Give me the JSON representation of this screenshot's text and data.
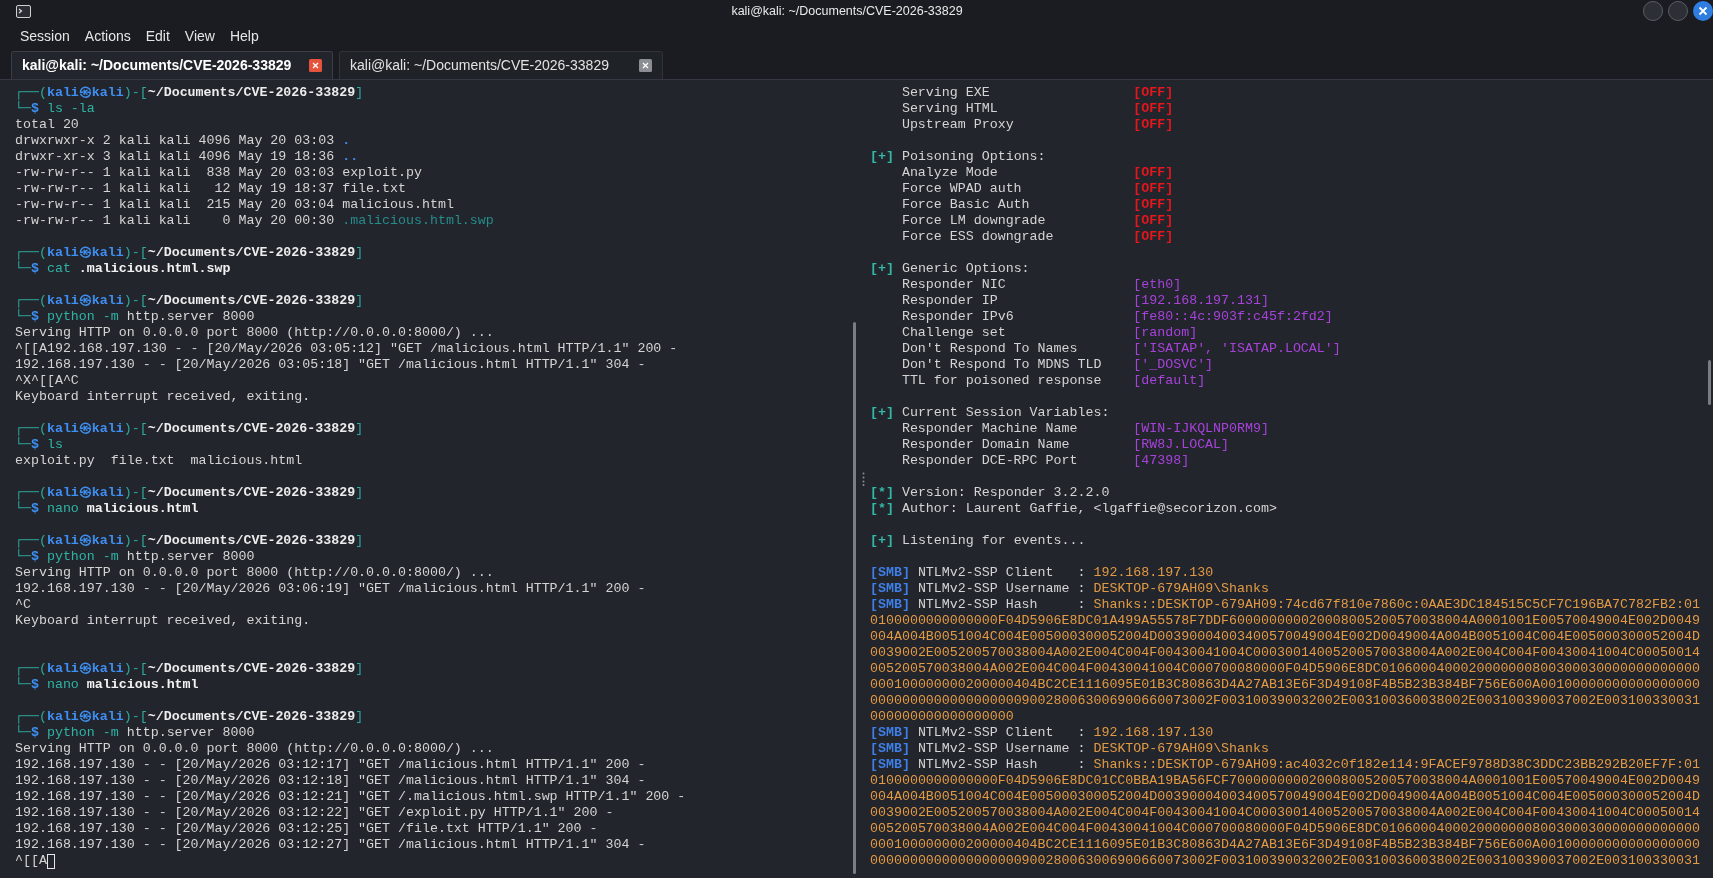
{
  "window": {
    "title": "kali@kali: ~/Documents/CVE-2026-33829"
  },
  "menu": [
    "Session",
    "Actions",
    "Edit",
    "View",
    "Help"
  ],
  "tabs": [
    {
      "label": "kali@kali: ~/Documents/CVE-2026-33829",
      "selected": true
    },
    {
      "label": "kali@kali: ~/Documents/CVE-2026-33829",
      "selected": false
    }
  ],
  "left_pane": {
    "blocks": [
      {
        "lines": [
          {
            "kind": "prompt",
            "open": "┌──(",
            "user": "kali㉿kali",
            "separator": ")-[",
            "path": "~/Documents/CVE-2026-33829",
            "close": "]"
          },
          {
            "kind": "command",
            "corner": "└─",
            "sigil": "$",
            "command": " ls -la"
          },
          {
            "kind": "output",
            "text": "total 20"
          },
          {
            "kind": "listing",
            "text": "drwxrwxr-x 2 kali kali 4096 May 20 03:03 ",
            "entry": {
              "kind": "directory",
              "text": "."
            }
          },
          {
            "kind": "listing",
            "text": "drwxr-xr-x 3 kali kali 4096 May 19 18:36 ",
            "entry": {
              "kind": "directory",
              "text": ".."
            }
          },
          {
            "kind": "output",
            "text": "-rw-rw-r-- 1 kali kali  838 May 20 03:03 exploit.py"
          },
          {
            "kind": "output",
            "text": "-rw-rw-r-- 1 kali kali   12 May 19 18:37 file.txt"
          },
          {
            "kind": "output",
            "text": "-rw-rw-r-- 1 kali kali  215 May 20 03:04 malicious.html"
          },
          {
            "kind": "listing",
            "text": "-rw-rw-r-- 1 kali kali    0 May 20 00:30 ",
            "entry": {
              "kind": "swap",
              "text": ".malicious.html.swp"
            }
          }
        ]
      },
      {
        "lines": [
          {
            "kind": "prompt",
            "open": "┌──(",
            "user": "kali㉿kali",
            "separator": ")-[",
            "path": "~/Documents/CVE-2026-33829",
            "close": "]"
          },
          {
            "kind": "command",
            "corner": "└─",
            "sigil": "$",
            "command": " cat",
            "file": " .malicious.html.swp"
          }
        ]
      },
      {
        "lines": [
          {
            "kind": "prompt",
            "open": "┌──(",
            "user": "kali㉿kali",
            "separator": ")-[",
            "path": "~/Documents/CVE-2026-33829",
            "close": "]"
          },
          {
            "kind": "command",
            "corner": "└─",
            "sigil": "$",
            "command": " python -m",
            "arguments": " http.server 8000"
          },
          {
            "kind": "output",
            "text": "Serving HTTP on 0.0.0.0 port 8000 (http://0.0.0.0:8000/) ..."
          },
          {
            "kind": "output",
            "text": "^[[A192.168.197.130 - - [20/May/2026 03:05:12] \"GET /malicious.html HTTP/1.1\" 200 -"
          },
          {
            "kind": "output",
            "text": "192.168.197.130 - - [20/May/2026 03:05:18] \"GET /malicious.html HTTP/1.1\" 304 -"
          },
          {
            "kind": "output",
            "text": "^X^[[A^C"
          },
          {
            "kind": "output",
            "text": "Keyboard interrupt received, exiting."
          }
        ]
      },
      {
        "lines": [
          {
            "kind": "prompt",
            "open": "┌──(",
            "user": "kali㉿kali",
            "separator": ")-[",
            "path": "~/Documents/CVE-2026-33829",
            "close": "]"
          },
          {
            "kind": "command",
            "corner": "└─",
            "sigil": "$",
            "command": " ls"
          },
          {
            "kind": "output",
            "text": "exploit.py  file.txt  malicious.html"
          }
        ]
      },
      {
        "lines": [
          {
            "kind": "prompt",
            "open": "┌──(",
            "user": "kali㉿kali",
            "separator": ")-[",
            "path": "~/Documents/CVE-2026-33829",
            "close": "]"
          },
          {
            "kind": "command",
            "corner": "└─",
            "sigil": "$",
            "command": " nano",
            "file": " malicious.html"
          }
        ]
      },
      {
        "lines": [
          {
            "kind": "prompt",
            "open": "┌──(",
            "user": "kali㉿kali",
            "separator": ")-[",
            "path": "~/Documents/CVE-2026-33829",
            "close": "]"
          },
          {
            "kind": "command",
            "corner": "└─",
            "sigil": "$",
            "command": " python -m",
            "arguments": " http.server 8000"
          },
          {
            "kind": "output",
            "text": "Serving HTTP on 0.0.0.0 port 8000 (http://0.0.0.0:8000/) ..."
          },
          {
            "kind": "output",
            "text": "192.168.197.130 - - [20/May/2026 03:06:19] \"GET /malicious.html HTTP/1.1\" 200 -"
          },
          {
            "kind": "output",
            "text": "^C"
          },
          {
            "kind": "output",
            "text": "Keyboard interrupt received, exiting."
          }
        ]
      },
      {
        "extra_gap": true,
        "lines": [
          {
            "kind": "prompt",
            "open": "┌──(",
            "user": "kali㉿kali",
            "separator": ")-[",
            "path": "~/Documents/CVE-2026-33829",
            "close": "]"
          },
          {
            "kind": "command",
            "corner": "└─",
            "sigil": "$",
            "command": " nano",
            "file": " malicious.html"
          }
        ]
      },
      {
        "lines": [
          {
            "kind": "prompt",
            "open": "┌──(",
            "user": "kali㉿kali",
            "separator": ")-[",
            "path": "~/Documents/CVE-2026-33829",
            "close": "]"
          },
          {
            "kind": "command",
            "corner": "└─",
            "sigil": "$",
            "command": " python -m",
            "arguments": " http.server 8000"
          },
          {
            "kind": "output",
            "text": "Serving HTTP on 0.0.0.0 port 8000 (http://0.0.0.0:8000/) ..."
          },
          {
            "kind": "output",
            "text": "192.168.197.130 - - [20/May/2026 03:12:17] \"GET /malicious.html HTTP/1.1\" 200 -"
          },
          {
            "kind": "output",
            "text": "192.168.197.130 - - [20/May/2026 03:12:18] \"GET /malicious.html HTTP/1.1\" 304 -"
          },
          {
            "kind": "output",
            "text": "192.168.197.130 - - [20/May/2026 03:12:21] \"GET /.malicious.html.swp HTTP/1.1\" 200 -"
          },
          {
            "kind": "output",
            "text": "192.168.197.130 - - [20/May/2026 03:12:22] \"GET /exploit.py HTTP/1.1\" 200 -"
          },
          {
            "kind": "output",
            "text": "192.168.197.130 - - [20/May/2026 03:12:25] \"GET /file.txt HTTP/1.1\" 200 -"
          },
          {
            "kind": "output",
            "text": "192.168.197.130 - - [20/May/2026 03:12:27] \"GET /malicious.html HTTP/1.1\" 304 -"
          },
          {
            "kind": "output",
            "cursor": true,
            "text": "^[[A"
          }
        ]
      }
    ]
  },
  "right_pane": {
    "blocks": [
      {
        "lines": [
          {
            "kind": "switch",
            "label": "Serving EXE",
            "value": "[OFF]"
          },
          {
            "kind": "switch",
            "label": "Serving HTML",
            "value": "[OFF]"
          },
          {
            "kind": "switch",
            "label": "Upstream Proxy",
            "value": "[OFF]"
          }
        ]
      },
      {
        "lines": [
          {
            "kind": "heading",
            "tag": "[+]",
            "text": " Poisoning Options:"
          },
          {
            "kind": "switch",
            "label": "Analyze Mode",
            "value": "[OFF]"
          },
          {
            "kind": "switch",
            "label": "Force WPAD auth",
            "value": "[OFF]"
          },
          {
            "kind": "switch",
            "label": "Force Basic Auth",
            "value": "[OFF]"
          },
          {
            "kind": "switch",
            "label": "Force LM downgrade",
            "value": "[OFF]"
          },
          {
            "kind": "switch",
            "label": "Force ESS downgrade",
            "value": "[OFF]"
          }
        ]
      },
      {
        "lines": [
          {
            "kind": "heading",
            "tag": "[+]",
            "text": " Generic Options:"
          },
          {
            "kind": "setting",
            "label": "Responder NIC",
            "value": "[eth0]"
          },
          {
            "kind": "setting",
            "label": "Responder IP",
            "value": "[192.168.197.131]"
          },
          {
            "kind": "setting",
            "label": "Responder IPv6",
            "value": "[fe80::4c:903f:c45f:2fd2]"
          },
          {
            "kind": "setting",
            "label": "Challenge set",
            "value": "[random]"
          },
          {
            "kind": "setting",
            "label": "Don't Respond To Names",
            "value": "['ISATAP', 'ISATAP.LOCAL']"
          },
          {
            "kind": "setting",
            "label": "Don't Respond To MDNS TLD",
            "value": "['_DOSVC']"
          },
          {
            "kind": "setting",
            "label": "TTL for poisoned response",
            "value": "[default]"
          }
        ]
      },
      {
        "lines": [
          {
            "kind": "heading",
            "tag": "[+]",
            "text": " Current Session Variables:"
          },
          {
            "kind": "setting",
            "label": "Responder Machine Name",
            "value": "[WIN-IJKQLNP0RM9]"
          },
          {
            "kind": "setting",
            "label": "Responder Domain Name",
            "value": "[RW8J.LOCAL]"
          },
          {
            "kind": "setting",
            "label": "Responder DCE-RPC Port",
            "value": "[47398]"
          }
        ]
      },
      {
        "lines": [
          {
            "kind": "heading",
            "tag": "[*]",
            "text": " Version: Responder 3.2.2.0"
          },
          {
            "kind": "heading",
            "tag": "[*]",
            "text": " Author: Laurent Gaffie, <lgaffie@secorizon.com>"
          }
        ]
      },
      {
        "lines": [
          {
            "kind": "heading",
            "tag": "[+]",
            "text": " Listening for events..."
          }
        ]
      },
      {
        "lines": [
          {
            "kind": "capture",
            "tag": "[SMB]",
            "field": " NTLMv2-SSP Client   : ",
            "value": "192.168.197.130"
          },
          {
            "kind": "capture",
            "tag": "[SMB]",
            "field": " NTLMv2-SSP Username : ",
            "value": "DESKTOP-679AH09\\Shanks"
          },
          {
            "kind": "capture",
            "tag": "[SMB]",
            "field": " NTLMv2-SSP Hash     : ",
            "value": "Shanks::DESKTOP-679AH09:74cd67f810e7860c:0AAE3DC184515C5CF7C196BA7C782FB2:010100000000000000F04D5906E8DC01A499A55578F7DDF600000000020008005200570038004A0001001E00570049004E002D0049004A004B0051004C004E005000300052004D00390004003400570049004E002D0049004A004B0051004C004E005000300052004D0039002E005200570038004A002E004C004F00430041004C00030014005200570038004A002E004C004F00430041004C00050014005200570038004A002E004C004F00430041004C000700080000F04D5906E8DC0106000400020000000800300030000000000000000100000000200000404BC2CE1116095E01B3C80863D4A27AB13E6F3D49108F4B5B23B384BF756E600A001000000000000000000000000000000000000900280063006900660073002F003100390032002E003100360038002E003100390037002E003100330031000000000000000000"
          },
          {
            "kind": "capture",
            "tag": "[SMB]",
            "field": " NTLMv2-SSP Client   : ",
            "value": "192.168.197.130"
          },
          {
            "kind": "capture",
            "tag": "[SMB]",
            "field": " NTLMv2-SSP Username : ",
            "value": "DESKTOP-679AH09\\Shanks"
          },
          {
            "kind": "capture",
            "tag": "[SMB]",
            "field": " NTLMv2-SSP Hash     : ",
            "value": "Shanks::DESKTOP-679AH09:ac4032c0f182e114:9FACEF9788D38C3DDC23BB292B20EF7F:010100000000000000F04D5906E8DC01CC0BBA19BA56FCF700000000020008005200570038004A0001001E00570049004E002D0049004A004B0051004C004E005000300052004D00390004003400570049004E002D0049004A004B0051004C004E005000300052004D0039002E005200570038004A002E004C004F00430041004C00030014005200570038004A002E004C004F00430041004C00050014005200570038004A002E004C004F00430041004C000700080000F04D5906E8DC0106000400020000000800300030000000000000000100000000200000404BC2CE1116095E01B3C80863D4A27AB13E6F3D49108F4B5B23B384BF756E600A001000000000000000000000000000000000000900280063006900660073002F003100390032002E003100360038002E003100390037002E003100330031"
          }
        ]
      }
    ]
  }
}
